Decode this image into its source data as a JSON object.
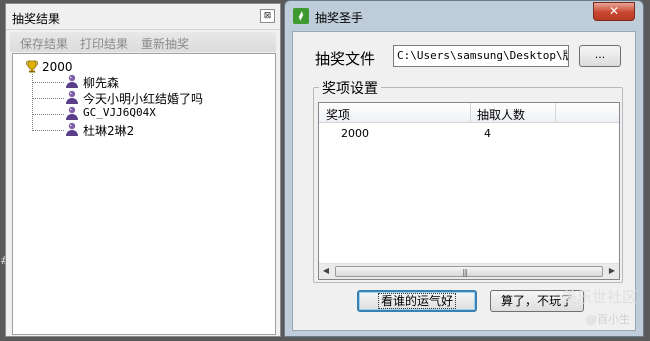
{
  "results_window": {
    "title": "抽奖结果",
    "close_glyph": "⊠",
    "menu": [
      "保存结果",
      "打印结果",
      "重新抽奖"
    ],
    "tree": {
      "root": "2000",
      "children": [
        "柳先森",
        "今天小明小红结婚了吗",
        "GC_VJJ6Q04X",
        "杜琳2琳2"
      ]
    }
  },
  "main_window": {
    "title": "抽奖圣手",
    "close_glyph": "✕",
    "file_label": "抽奖文件",
    "file_path": "C:\\Users\\samsung\\Desktop\\版块",
    "browse_label": "...",
    "group_label": "奖项设置",
    "columns": [
      "奖项",
      "抽取人数"
    ],
    "rows": [
      [
        "2000",
        "4"
      ]
    ],
    "lucky_button": "看谁的运气好",
    "forget_button": "算了，不玩了"
  },
  "watermark": {
    "line1": "美乐世社区",
    "line2": "@百小生"
  },
  "colors": {
    "close_red": "#c9472f",
    "default_button_border": "#3c7fb1",
    "app_icon_green": "#3c9a2e"
  }
}
